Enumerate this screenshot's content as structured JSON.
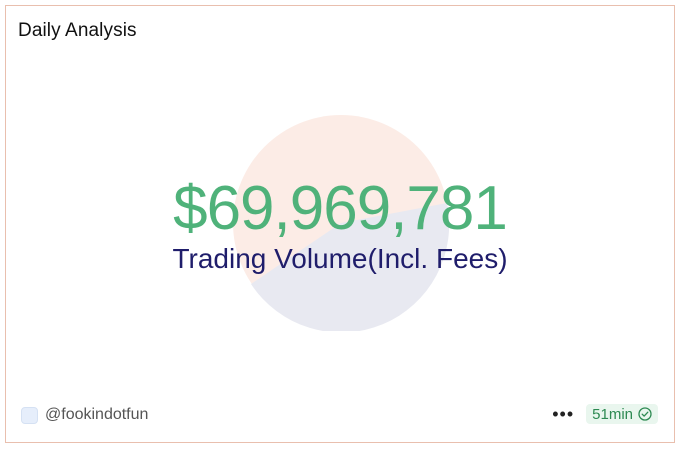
{
  "card": {
    "title": "Daily Analysis",
    "metric_value": "$69,969,781",
    "metric_label": "Trading Volume(Incl. Fees)",
    "pie_colors": [
      "#fcece6",
      "#e8e9f1"
    ]
  },
  "footer": {
    "author": "@fookindotfun",
    "more_icon": "more-icon",
    "time_label": "51min",
    "status_icon": "check-circle-icon",
    "status_color": "#2d8a52"
  }
}
